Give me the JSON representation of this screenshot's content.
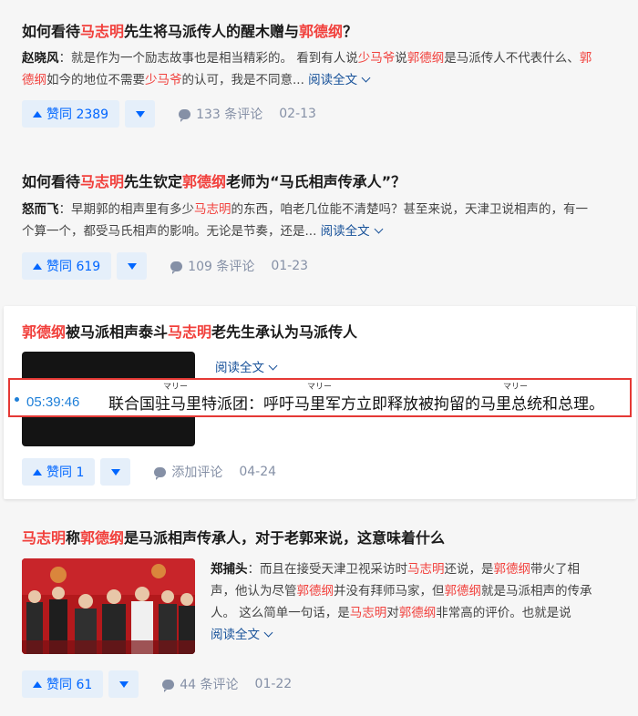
{
  "items": [
    {
      "title": [
        "如何看待",
        "马志明",
        "先生将马派传人的醒木赠与",
        "郭德纲",
        "？"
      ],
      "author": "赵晓风",
      "excerpt_line1": [
        "：就是作为一个励志故事也是相当精彩的。 看到有人说",
        "少马爷",
        "说",
        "郭德纲",
        "是马派传人不代表什么、",
        "郭"
      ],
      "excerpt_line2": [
        "德纲",
        "如今的地位不需要",
        "少马爷",
        "的认可，我是不同意... "
      ],
      "read_more": "阅读全文",
      "votes": "赞同 2389",
      "comments": "133 条评论",
      "date": "02-13"
    },
    {
      "title": [
        "如何看待",
        "马志明",
        "先生钦定",
        "郭德纲",
        "老师为“马氏相声传承人”？"
      ],
      "author": "怒而飞",
      "excerpt_line1": [
        "：早期郭的相声里有多少",
        "马志明",
        "的东西，咱老几位能不清楚吗？甚至来说，天津卫说相声的，有一"
      ],
      "excerpt_line2": [
        "个算一个，都受马氏相声的影响。无论是节奏，还是... "
      ],
      "read_more": "阅读全文",
      "votes": "赞同 619",
      "comments": "109 条评论",
      "date": "01-23"
    },
    {
      "title": [
        "郭德纲",
        "被马派相声泰斗",
        "马志明",
        "老先生承认为马派传人"
      ],
      "read_more": "阅读全文",
      "votes": "赞同 1",
      "comments": "添加评论",
      "date": "04-24"
    },
    {
      "title": [
        "马志明",
        "称",
        "郭德纲",
        "是马派相声传承人，对于老郭来说，这意味着什么"
      ],
      "author": "郑捕头",
      "excerpt_line1": [
        "：而且在接受天津卫视采访时",
        "马志明",
        "还说，是",
        "郭德纲",
        "带火了相"
      ],
      "excerpt_line2": [
        "声，他认为尽管",
        "郭德纲",
        "并没有拜师马家，但",
        "郭德纲",
        "就是马派相声的传承"
      ],
      "excerpt_line3": [
        "人。 这么简单一句话，是",
        "马志明",
        "对",
        "郭德纲",
        "非常高的评价。也就是说"
      ],
      "read_more": "阅读全文",
      "votes": "赞同 61",
      "comments": "44 条评论",
      "date": "01-22"
    }
  ],
  "subtitle": {
    "time": "05:39:46",
    "text": "联合国驻马里特派团：呼吁马里军方立即释放被拘留的马里总统和总理。",
    "ruby": [
      "マリー",
      "マリー",
      "マリー"
    ]
  },
  "colors": {
    "highlight": "#f1403c",
    "link": "#175199",
    "vote": "#0066ff",
    "subtitle_border": "#e53935"
  }
}
